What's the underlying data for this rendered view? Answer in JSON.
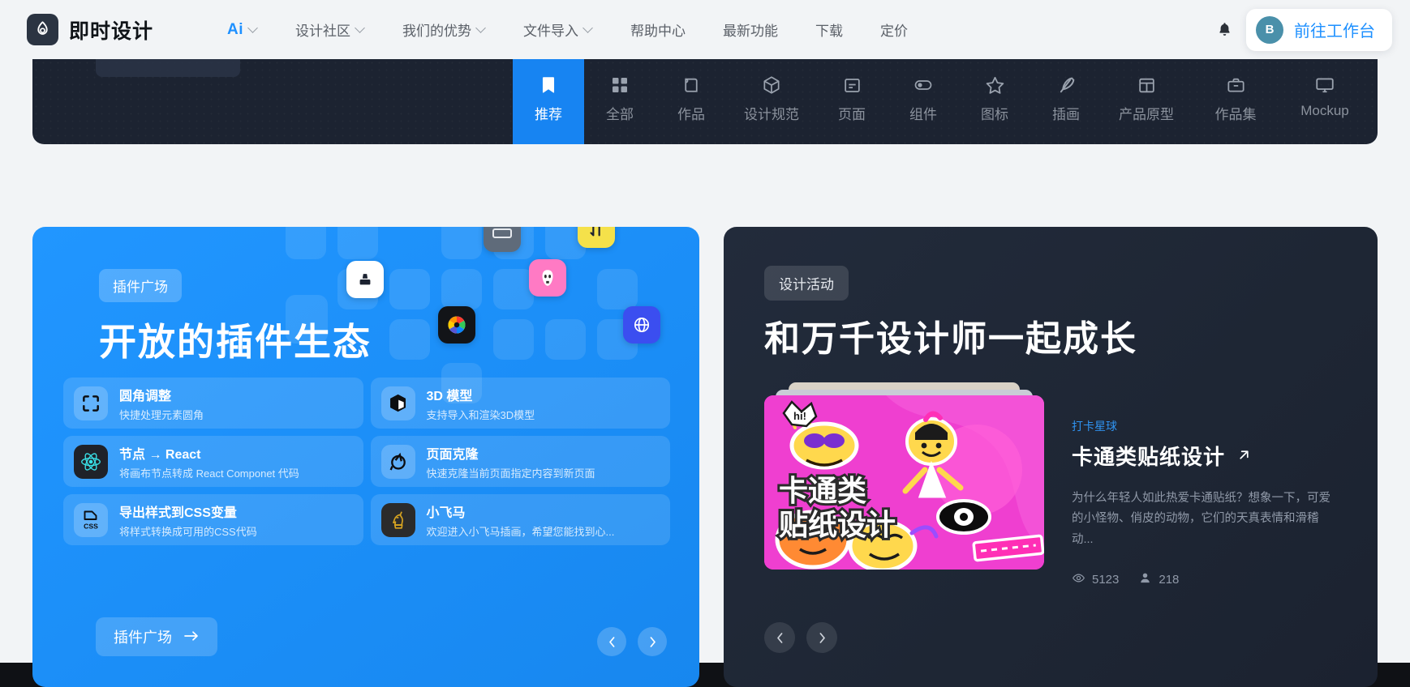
{
  "header": {
    "brand": {
      "name": "即时设计",
      "logo_icon": "flame-logo-icon"
    },
    "nav_items": [
      {
        "label": "Ai",
        "has_dropdown": true,
        "accent": true
      },
      {
        "label": "设计社区",
        "has_dropdown": true
      },
      {
        "label": "我们的优势",
        "has_dropdown": true
      },
      {
        "label": "文件导入",
        "has_dropdown": true
      },
      {
        "label": "帮助中心",
        "has_dropdown": false
      },
      {
        "label": "最新功能",
        "has_dropdown": false
      },
      {
        "label": "下载",
        "has_dropdown": false
      },
      {
        "label": "定价",
        "has_dropdown": false
      }
    ],
    "notification_icon": "bell-icon",
    "workbench": {
      "avatar_initial": "B",
      "label": "前往工作台"
    }
  },
  "category_tabs": [
    {
      "label": "推荐",
      "icon": "bookmark-icon",
      "active": true
    },
    {
      "label": "全部",
      "icon": "grid-icon",
      "active": false
    },
    {
      "label": "作品",
      "icon": "artboard-icon",
      "active": false
    },
    {
      "label": "设计规范",
      "icon": "cube-icon",
      "active": false
    },
    {
      "label": "页面",
      "icon": "page-icon",
      "active": false
    },
    {
      "label": "组件",
      "icon": "toggle-icon",
      "active": false
    },
    {
      "label": "图标",
      "icon": "star-icon",
      "active": false
    },
    {
      "label": "插画",
      "icon": "feather-icon",
      "active": false
    },
    {
      "label": "产品原型",
      "icon": "layout-icon",
      "active": false
    },
    {
      "label": "作品集",
      "icon": "briefcase-icon",
      "active": false
    },
    {
      "label": "Mockup",
      "icon": "monitor-icon",
      "active": false
    }
  ],
  "plugin_card": {
    "tag": "插件广场",
    "title": "开放的插件生态",
    "plugins": [
      {
        "name": "圆角调整",
        "desc": "快捷处理元素圆角",
        "icon": "corner-radius-icon"
      },
      {
        "name": "3D 模型",
        "desc": "支持导入和渲染3D模型",
        "icon": "cube-3d-icon"
      },
      {
        "name": "节点 → React",
        "desc": "将画布节点转成 React Componet 代码",
        "icon": "react-icon"
      },
      {
        "name": "页面克隆",
        "desc": "快速克隆当前页面指定内容到新页面",
        "icon": "clone-icon"
      },
      {
        "name": "导出样式到CSS变量",
        "desc": "将样式转换成可用的CSS代码",
        "icon": "css-file-icon"
      },
      {
        "name": "小飞马",
        "desc": "欢迎进入小飞马插画，希望您能找到心...",
        "icon": "pegasus-icon"
      }
    ],
    "cta_label": "插件广场",
    "cta_icon": "arrow-right-icon",
    "prev_icon": "chevron-left-icon",
    "next_icon": "chevron-right-icon",
    "accent_color": "#1b8ef7"
  },
  "event_card": {
    "tag": "设计活动",
    "title": "和万千设计师一起成长",
    "item": {
      "category": "打卡星球",
      "title": "卡通类贴纸设计",
      "link_icon": "arrow-up-right-icon",
      "description": "为什么年轻人如此热爱卡通贴纸？想象一下，可爱的小怪物、俏皮的动物，它们的天真表情和滑稽动...",
      "thumbnail_title_line1": "卡通类",
      "thumbnail_title_line2": "贴纸设计",
      "thumbnail_badge": "hi!",
      "views": "5123",
      "views_icon": "eye-icon",
      "participants": "218",
      "participants_icon": "person-icon"
    },
    "prev_icon": "chevron-left-icon",
    "next_icon": "chevron-right-icon",
    "background_color": "#222b3b"
  },
  "colors": {
    "page_background": "#f2f4f6",
    "panel_dark": "#1c2331",
    "accent_blue": "#1784f2",
    "link_blue": "#1e90ff"
  }
}
